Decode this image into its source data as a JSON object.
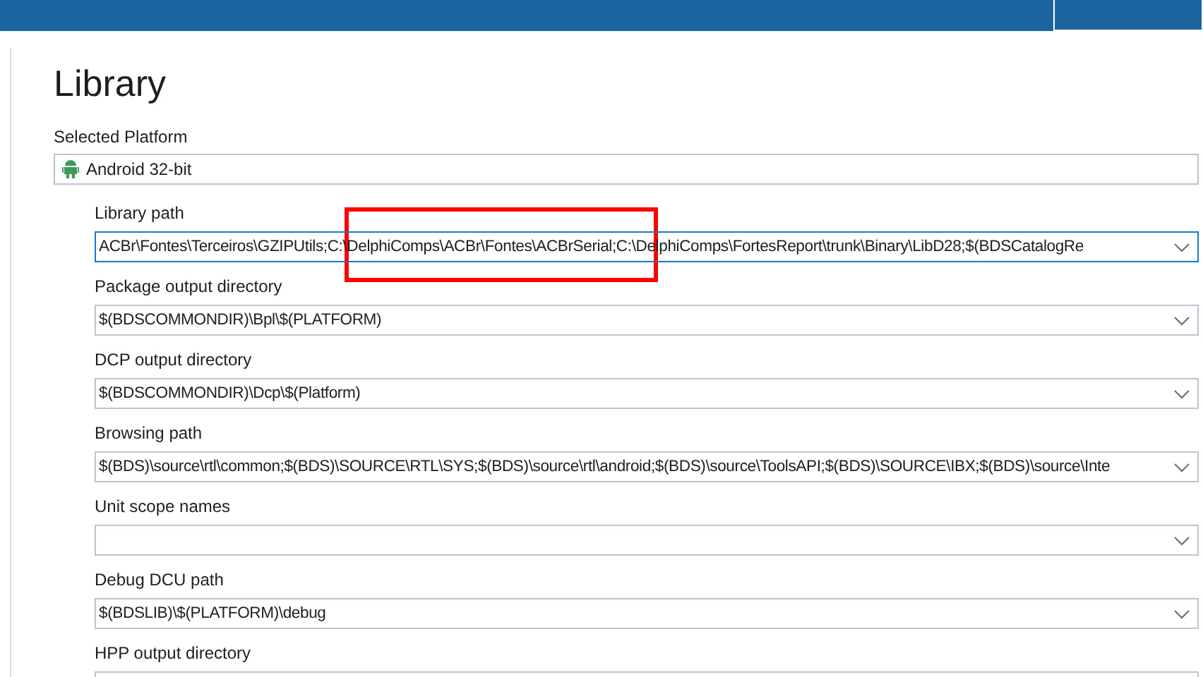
{
  "page_title": "Library",
  "platform": {
    "label": "Selected Platform",
    "value": "Android 32-bit"
  },
  "fields": [
    {
      "label": "Library path",
      "value": "ACBr\\Fontes\\Terceiros\\GZIPUtils;C:\\DelphiComps\\ACBr\\Fontes\\ACBrSerial;C:\\DelphiComps\\FortesReport\\trunk\\Binary\\LibD28;$(BDSCatalogRe",
      "focused": true
    },
    {
      "label": "Package output directory",
      "value": "$(BDSCOMMONDIR)\\Bpl\\$(PLATFORM)",
      "focused": false
    },
    {
      "label": "DCP output directory",
      "value": "$(BDSCOMMONDIR)\\Dcp\\$(Platform)",
      "focused": false
    },
    {
      "label": "Browsing path",
      "value": "$(BDS)\\source\\rtl\\common;$(BDS)\\SOURCE\\RTL\\SYS;$(BDS)\\source\\rtl\\android;$(BDS)\\source\\ToolsAPI;$(BDS)\\SOURCE\\IBX;$(BDS)\\source\\Inte",
      "focused": false
    },
    {
      "label": "Unit scope names",
      "focused": false
    },
    {
      "label": "Debug DCU path",
      "value": "$(BDSLIB)\\$(PLATFORM)\\debug",
      "focused": false
    },
    {
      "label": "HPP output directory",
      "focused": false
    }
  ]
}
